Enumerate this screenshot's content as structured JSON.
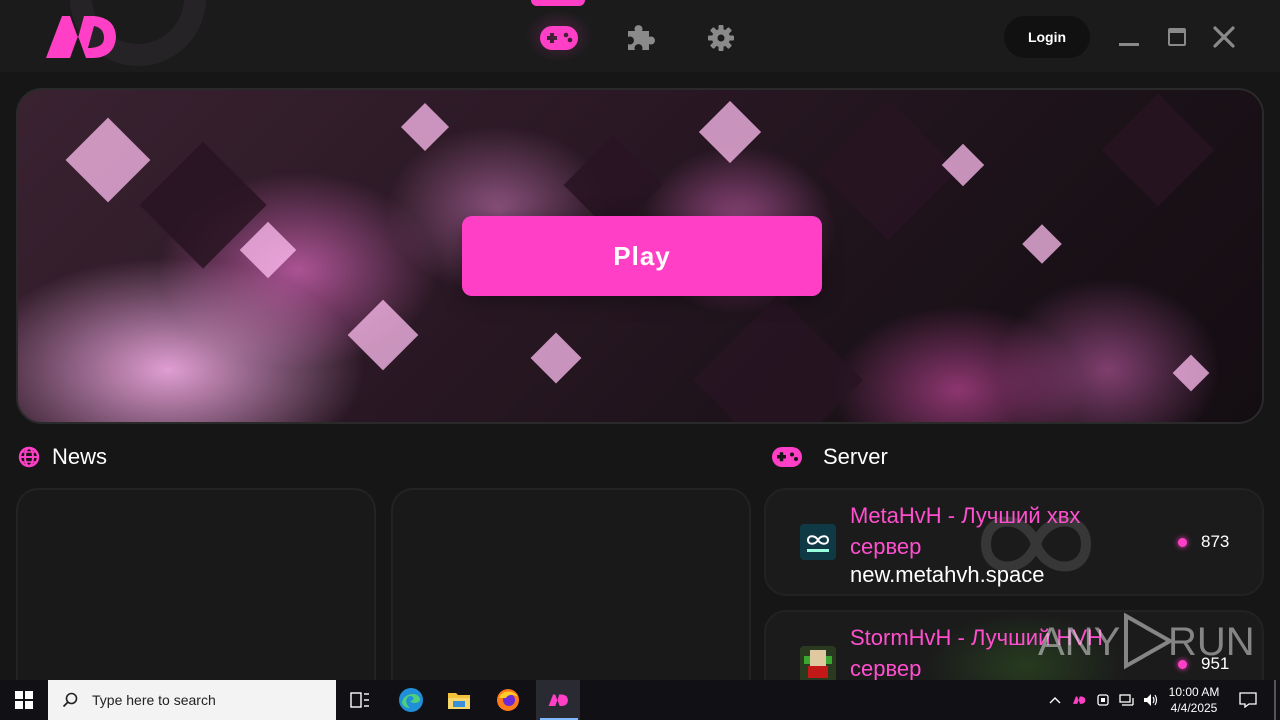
{
  "app": {
    "brand_color": "#ff3fc6",
    "nav": [
      {
        "name": "games",
        "icon": "gamepad-icon",
        "active": true
      },
      {
        "name": "mods",
        "icon": "puzzle-icon",
        "active": false
      },
      {
        "name": "settings",
        "icon": "gear-icon",
        "active": false
      }
    ],
    "login_label": "Login",
    "play_label": "Play"
  },
  "news": {
    "title": "News"
  },
  "servers": {
    "title": "Server",
    "items": [
      {
        "name": "MetaHvH - Лучший хвх сервер",
        "address": "new.metahvh.space",
        "online": "873",
        "icon": "metahvh-logo-icon"
      },
      {
        "name": "StormHvH - Лучший HVH сервер",
        "address": "",
        "online": "951",
        "icon": "stormhvh-logo-icon"
      }
    ]
  },
  "taskbar": {
    "search_placeholder": "Type here to search",
    "time": "10:00 AM",
    "date": "4/4/2025"
  },
  "watermark": {
    "text_left": "ANY",
    "text_right": "RUN"
  }
}
